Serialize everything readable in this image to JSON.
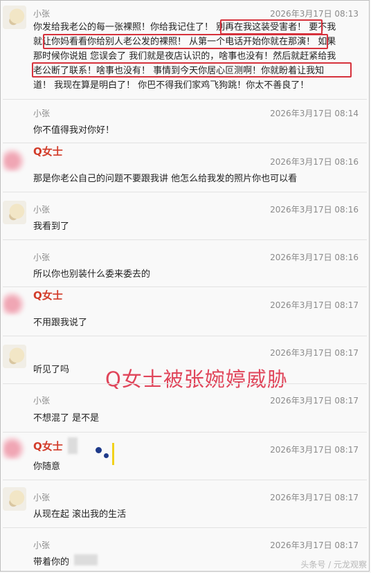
{
  "messages": [
    {
      "sender": "小张",
      "time": "2026年3月17日 08:13",
      "lines": [
        "你发给我老公的每一张裸照！你给我记住了！ 别再在我这装受害者！  要不我",
        "就让你妈看看你给别人老公发的裸照！ 从第一个电话开始你就在那演！ 如果",
        "那时候你说姐 您误会了 我们就是夜店认识的，啥事也没有！然后就赶紧给我",
        "老公断了联系！啥事也没有！ 事情到今天你居心叵测啊！你就盼着让我知",
        "道！ 我现在算是明白了！ 你巴不得我们家鸡飞狗跳！你太不善良了！"
      ]
    },
    {
      "sender": "小张",
      "time": "2026年3月17日 08:14",
      "text": "你不值得我对你好！"
    },
    {
      "sender": "Q女士",
      "time": "2026年3月17日 08:16",
      "text": "那是你老公自己的问题不要跟我讲 他怎么给我发的照片你也可以看"
    },
    {
      "sender": "小张",
      "time": "2026年3月17日 08:16",
      "text": "我看到了"
    },
    {
      "sender": "小张",
      "time": "2026年3月17日 08:16",
      "text": "所以你也别装什么委来委去的"
    },
    {
      "sender": "Q女士",
      "time": "2026年3月17日 08:17",
      "text": "不用跟我说了"
    },
    {
      "sender": "小张",
      "time": "2026年3月17日 08:17",
      "text": "听见了吗"
    },
    {
      "sender": "小张",
      "time": "2026年3月17日 08:17",
      "text": "不想混了 是不是"
    },
    {
      "sender": "Q女士",
      "time": "2026年3月17日 08:17",
      "text": "你随意"
    },
    {
      "sender": "小张",
      "time": "2026年3月17日 08:17",
      "text": "从现在起 滚出我的生活"
    },
    {
      "sender": "小张",
      "time": "2026年3月17日 08:17",
      "text": "带着你的"
    }
  ],
  "overlay_caption": "Q女士被张婉婷威胁",
  "watermark": "头条号 / 元龙观察"
}
